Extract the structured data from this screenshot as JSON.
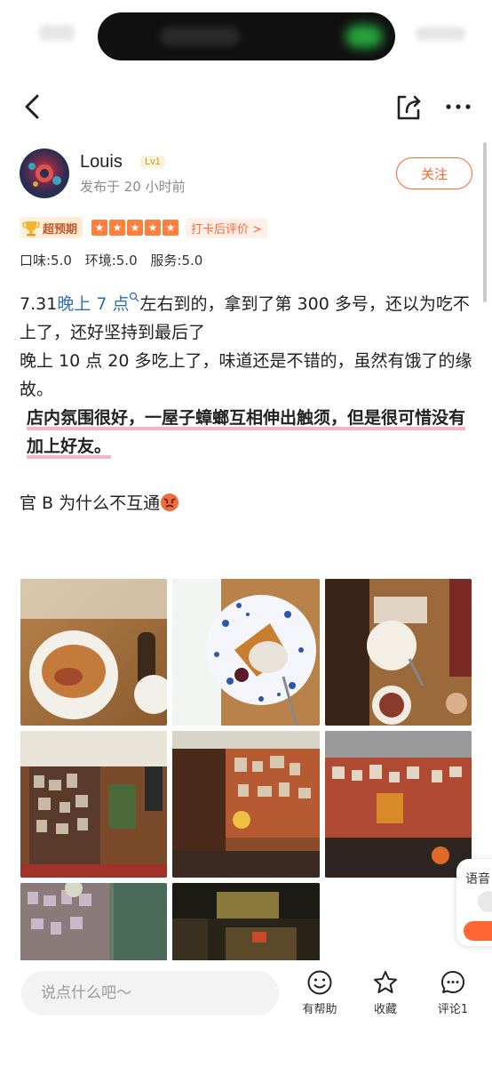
{
  "author": {
    "name": "Louis",
    "level": "Lv1",
    "post_time": "发布于 20 小时前",
    "follow_label": "关注"
  },
  "rating": {
    "expect_label": "超预期",
    "stars": 5,
    "checkin_label": "打卡后评价 >",
    "scores": {
      "taste": "口味:5.0",
      "environment": "环境:5.0",
      "service": "服务:5.0"
    }
  },
  "post": {
    "line1_prefix": "7.31",
    "line1_link": "晚上 7 点",
    "line1_suffix": "左右到的，拿到了第 300 多号，还以为吃不上了，还好坚持到最后了",
    "line2": "晚上 10 点 20 多吃上了，味道还是不错的，虽然有饿了的缘故。",
    "line3": "店内氛围很好，一屋子蟑螂互相伸出触须，但是很可惜没有加上好友。",
    "line4": "官 B 为什么不互通"
  },
  "photos": [
    {
      "name": "photo-food-noodles"
    },
    {
      "name": "photo-food-dessert"
    },
    {
      "name": "photo-table-plates"
    },
    {
      "name": "photo-wall-stickers-1"
    },
    {
      "name": "photo-wall-stickers-2"
    },
    {
      "name": "photo-wall-stickers-3"
    },
    {
      "name": "photo-wall-stickers-4"
    },
    {
      "name": "photo-street-night"
    }
  ],
  "bottom_bar": {
    "comment_placeholder": "说点什么吧～",
    "helpful_label": "有帮助",
    "favorite_label": "收藏",
    "comment_label": "评论1"
  },
  "voice_float": {
    "label": "语音"
  },
  "colors": {
    "accent": "#ff6633",
    "link": "#2f6fb4"
  }
}
